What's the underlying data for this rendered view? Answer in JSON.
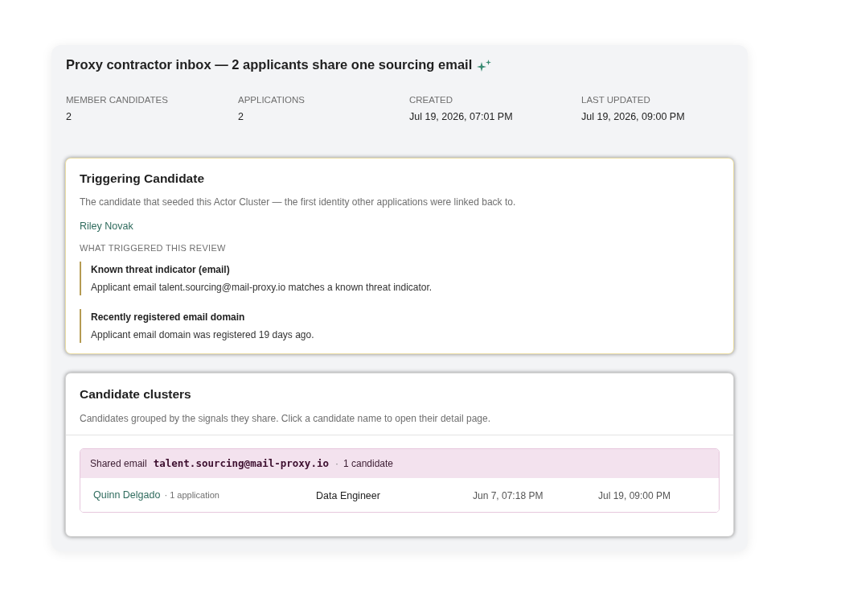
{
  "header": {
    "title": "Proxy contractor inbox — 2 applicants share one sourcing email"
  },
  "stats": [
    {
      "label": "MEMBER CANDIDATES",
      "value": "2"
    },
    {
      "label": "APPLICATIONS",
      "value": "2"
    },
    {
      "label": "CREATED",
      "value": "Jul 19, 2026, 07:01 PM"
    },
    {
      "label": "LAST UPDATED",
      "value": "Jul 19, 2026, 09:00 PM"
    }
  ],
  "triggering_candidate": {
    "title": "Triggering Candidate",
    "description": "The candidate that seeded this Actor Cluster — the first identity other applications were linked back to.",
    "candidate_name": "Riley Novak",
    "review_heading": "WHAT TRIGGERED THIS REVIEW",
    "triggers": [
      {
        "title": "Known threat indicator (email)",
        "detail": "Applicant email talent.sourcing@mail-proxy.io matches a known threat indicator."
      },
      {
        "title": "Recently registered email domain",
        "detail": "Applicant email domain was registered 19 days ago."
      }
    ]
  },
  "candidate_clusters": {
    "title": "Candidate clusters",
    "description": "Candidates grouped by the signals they share. Click a candidate name to open their detail page.",
    "clusters": [
      {
        "signal_label": "Shared email",
        "signal_value": "talent.sourcing@mail-proxy.io",
        "separator": "·",
        "count": "1 candidate",
        "candidates": [
          {
            "name": "Quinn Delgado",
            "applications": "· 1 application",
            "role": "Data Engineer",
            "date_1": "Jun 7, 07:18 PM",
            "date_2": "Jul 19, 09:00 PM"
          }
        ]
      }
    ]
  }
}
